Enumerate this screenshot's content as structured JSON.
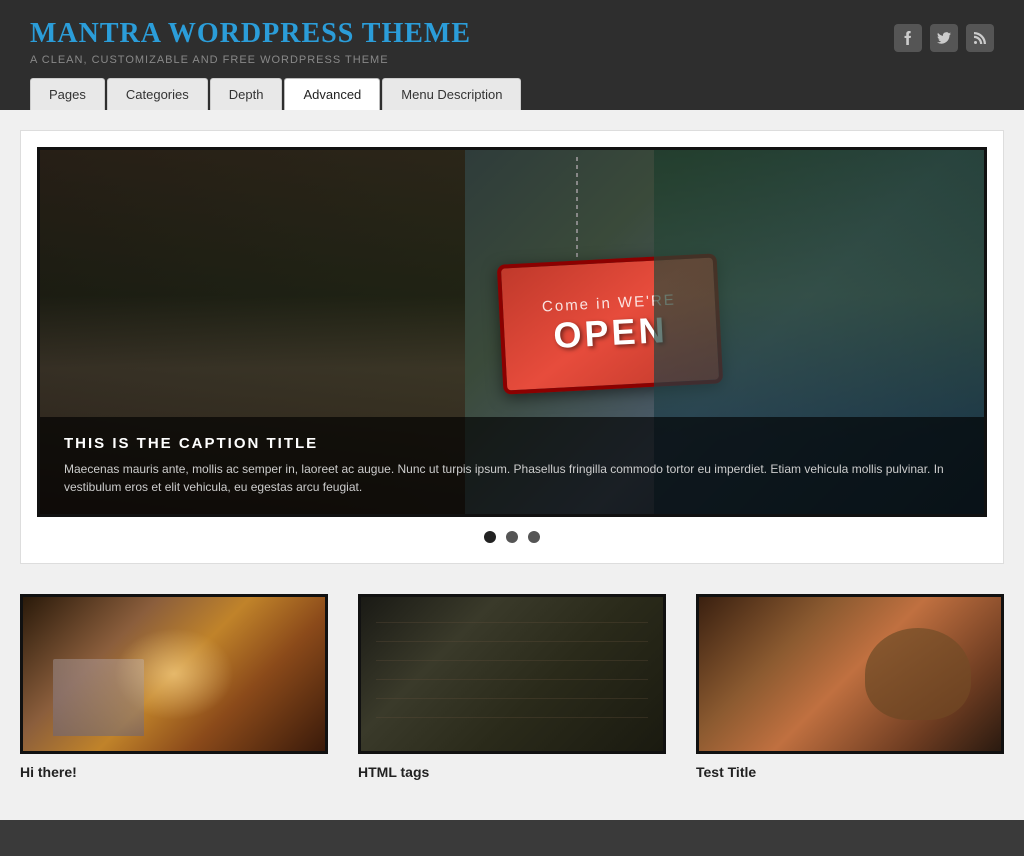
{
  "header": {
    "site_title": "Mantra WordPress Theme",
    "site_tagline": "A Clean, Customizable and Free WordPress Theme"
  },
  "social": {
    "facebook_label": "f",
    "twitter_label": "t",
    "rss_label": "rss"
  },
  "tabs": [
    {
      "id": "pages",
      "label": "Pages",
      "active": false
    },
    {
      "id": "categories",
      "label": "Categories",
      "active": false
    },
    {
      "id": "depth",
      "label": "Depth",
      "active": false
    },
    {
      "id": "advanced",
      "label": "Advanced",
      "active": true
    },
    {
      "id": "menu-description",
      "label": "Menu Description",
      "active": false
    }
  ],
  "slider": {
    "caption_title": "This is the Caption Title",
    "caption_text": "Maecenas mauris ante, mollis ac semper in, laoreet ac augue. Nunc ut turpis ipsum. Phasellus fringilla commodo tortor eu imperdiet. Etiam vehicula mollis pulvinar. In vestibulum eros et elit vehicula, eu egestas arcu feugiat.",
    "sign_line1": "Come in",
    "sign_line2_prefix": "WE'RE",
    "sign_main": "OPEN",
    "dots": [
      {
        "index": 0,
        "active": true
      },
      {
        "index": 1,
        "active": false
      },
      {
        "index": 2,
        "active": false
      }
    ]
  },
  "posts": [
    {
      "id": 1,
      "title": "Hi there!",
      "thumb_class": "thumb-1"
    },
    {
      "id": 2,
      "title": "HTML tags",
      "thumb_class": "thumb-2"
    },
    {
      "id": 3,
      "title": "Test Title",
      "thumb_class": "thumb-3"
    }
  ]
}
